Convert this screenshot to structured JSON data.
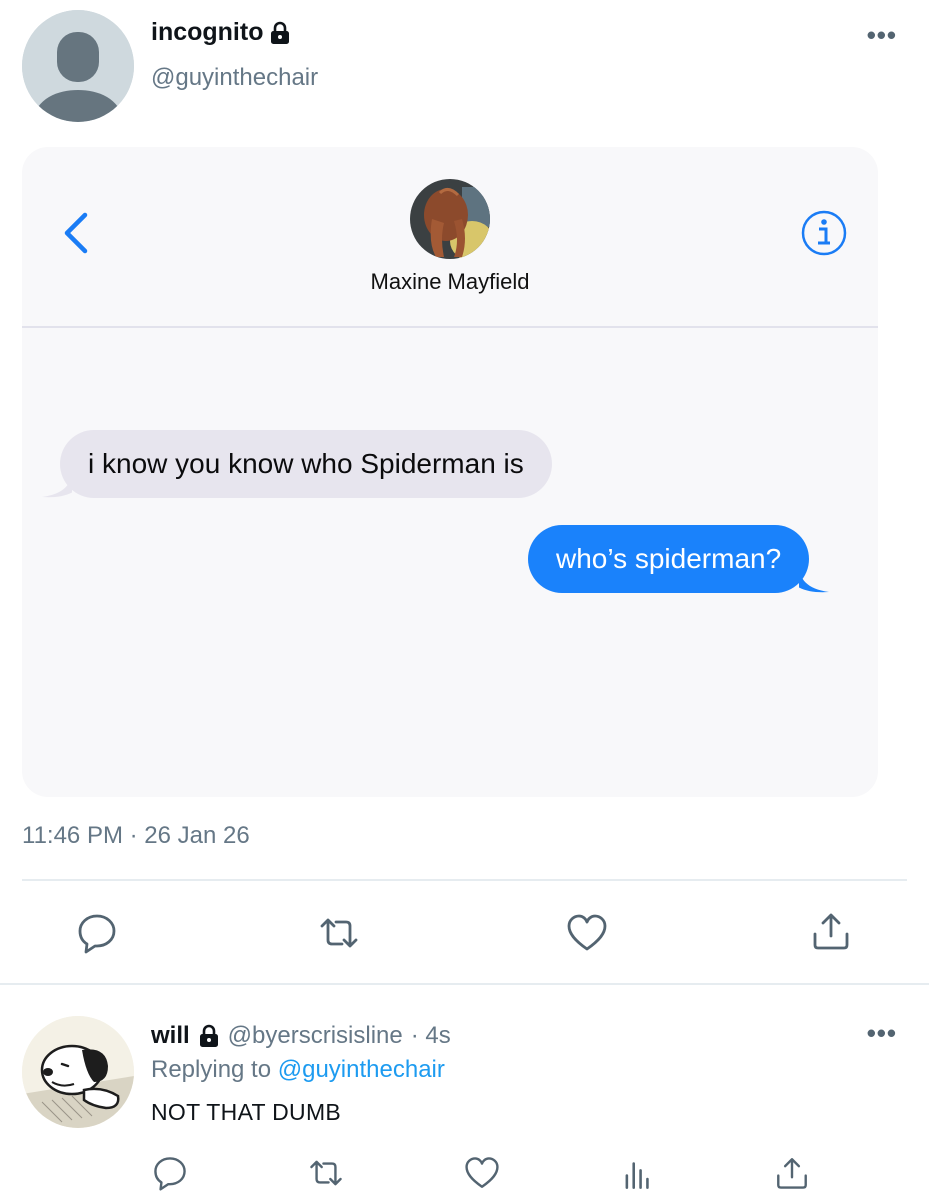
{
  "tweet": {
    "author_name": "incognito",
    "author_handle": "@guyinthechair",
    "more_label": "•••",
    "timestamp": "11:46 PM · 26 Jan 26",
    "icons": [
      "reply-icon",
      "retweet-icon",
      "like-icon",
      "share-icon"
    ]
  },
  "message_screenshot": {
    "contact_name": "Maxine Mayfield",
    "messages": [
      {
        "direction": "incoming",
        "text": "i know you know who Spiderman is"
      },
      {
        "direction": "outgoing",
        "text": "who’s spiderman?"
      }
    ],
    "colors": {
      "incoming_bubble": "#e7e5ee",
      "outgoing_bubble": "#1a82fb",
      "accent": "#1a7cf5"
    }
  },
  "reply": {
    "author_name": "will",
    "author_handle": "@byerscrisisline",
    "time": "· 4s",
    "replying_prefix": "Replying to",
    "replying_to": "@guyinthechair",
    "text": "NOT THAT DUMB",
    "more_label": "•••"
  }
}
